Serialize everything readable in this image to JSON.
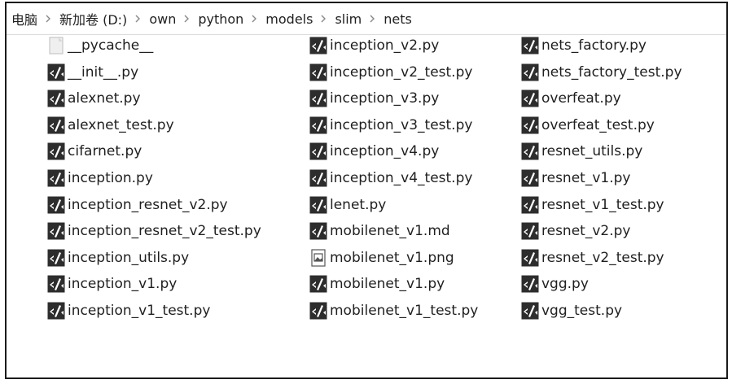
{
  "breadcrumb": [
    "电脑",
    "新加卷 (D:)",
    "own",
    "python",
    "models",
    "slim",
    "nets"
  ],
  "columns": [
    [
      {
        "name": "__pycache__",
        "icon": "folder-icon"
      },
      {
        "name": "__init__.py",
        "icon": "python-file-icon"
      },
      {
        "name": "alexnet.py",
        "icon": "python-file-icon"
      },
      {
        "name": "alexnet_test.py",
        "icon": "python-file-icon"
      },
      {
        "name": "cifarnet.py",
        "icon": "python-file-icon"
      },
      {
        "name": "inception.py",
        "icon": "python-file-icon"
      },
      {
        "name": "inception_resnet_v2.py",
        "icon": "python-file-icon"
      },
      {
        "name": "inception_resnet_v2_test.py",
        "icon": "python-file-icon"
      },
      {
        "name": "inception_utils.py",
        "icon": "python-file-icon"
      },
      {
        "name": "inception_v1.py",
        "icon": "python-file-icon"
      },
      {
        "name": "inception_v1_test.py",
        "icon": "python-file-icon"
      }
    ],
    [
      {
        "name": "inception_v2.py",
        "icon": "python-file-icon"
      },
      {
        "name": "inception_v2_test.py",
        "icon": "python-file-icon"
      },
      {
        "name": "inception_v3.py",
        "icon": "python-file-icon"
      },
      {
        "name": "inception_v3_test.py",
        "icon": "python-file-icon"
      },
      {
        "name": "inception_v4.py",
        "icon": "python-file-icon"
      },
      {
        "name": "inception_v4_test.py",
        "icon": "python-file-icon"
      },
      {
        "name": "lenet.py",
        "icon": "python-file-icon"
      },
      {
        "name": "mobilenet_v1.md",
        "icon": "python-file-icon"
      },
      {
        "name": "mobilenet_v1.png",
        "icon": "image-file-icon"
      },
      {
        "name": "mobilenet_v1.py",
        "icon": "python-file-icon"
      },
      {
        "name": "mobilenet_v1_test.py",
        "icon": "python-file-icon"
      }
    ],
    [
      {
        "name": "nets_factory.py",
        "icon": "python-file-icon"
      },
      {
        "name": "nets_factory_test.py",
        "icon": "python-file-icon"
      },
      {
        "name": "overfeat.py",
        "icon": "python-file-icon"
      },
      {
        "name": "overfeat_test.py",
        "icon": "python-file-icon"
      },
      {
        "name": "resnet_utils.py",
        "icon": "python-file-icon"
      },
      {
        "name": "resnet_v1.py",
        "icon": "python-file-icon"
      },
      {
        "name": "resnet_v1_test.py",
        "icon": "python-file-icon"
      },
      {
        "name": "resnet_v2.py",
        "icon": "python-file-icon"
      },
      {
        "name": "resnet_v2_test.py",
        "icon": "python-file-icon"
      },
      {
        "name": "vgg.py",
        "icon": "python-file-icon"
      },
      {
        "name": "vgg_test.py",
        "icon": "python-file-icon"
      }
    ]
  ]
}
